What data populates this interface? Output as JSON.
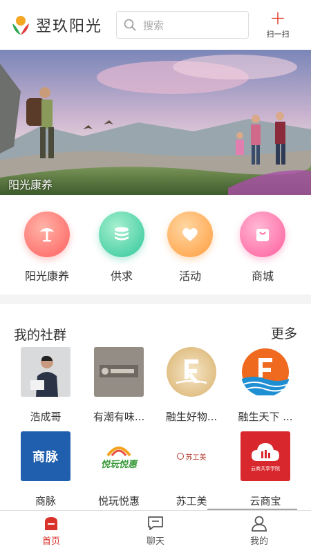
{
  "header": {
    "app_title": "翌玖阳光",
    "search_placeholder": "搜索",
    "scan_label": "扫一扫"
  },
  "banner": {
    "caption": "阳光康养"
  },
  "quick_nav": [
    {
      "label": "阳光康养",
      "icon": "palm-tree-icon",
      "color": "#ff6b6b"
    },
    {
      "label": "供求",
      "icon": "coins-icon",
      "color": "#3fcf9e"
    },
    {
      "label": "活动",
      "icon": "heart-icon",
      "color": "#ffad5a"
    },
    {
      "label": "商城",
      "icon": "shopping-bag-icon",
      "color": "#ff6fa5"
    }
  ],
  "community": {
    "title": "我的社群",
    "more_label": "更多",
    "groups": [
      {
        "name": "浩成哥"
      },
      {
        "name": "有潮有味..."
      },
      {
        "name": "融生好物..."
      },
      {
        "name": "融生天下 ..."
      },
      {
        "name": "商脉",
        "logo_text": "商脉"
      },
      {
        "name": "悦玩悦惠",
        "logo_text": "悦玩悦惠"
      },
      {
        "name": "苏工美",
        "logo_text": "苏工美"
      },
      {
        "name": "云商宝",
        "logo_text": "云商共享学院"
      }
    ]
  },
  "tabbar": [
    {
      "label": "首页",
      "active": true
    },
    {
      "label": "聊天",
      "active": false
    },
    {
      "label": "我的",
      "active": false
    }
  ],
  "colors": {
    "accent": "#d8322b",
    "inactive": "#555555"
  }
}
